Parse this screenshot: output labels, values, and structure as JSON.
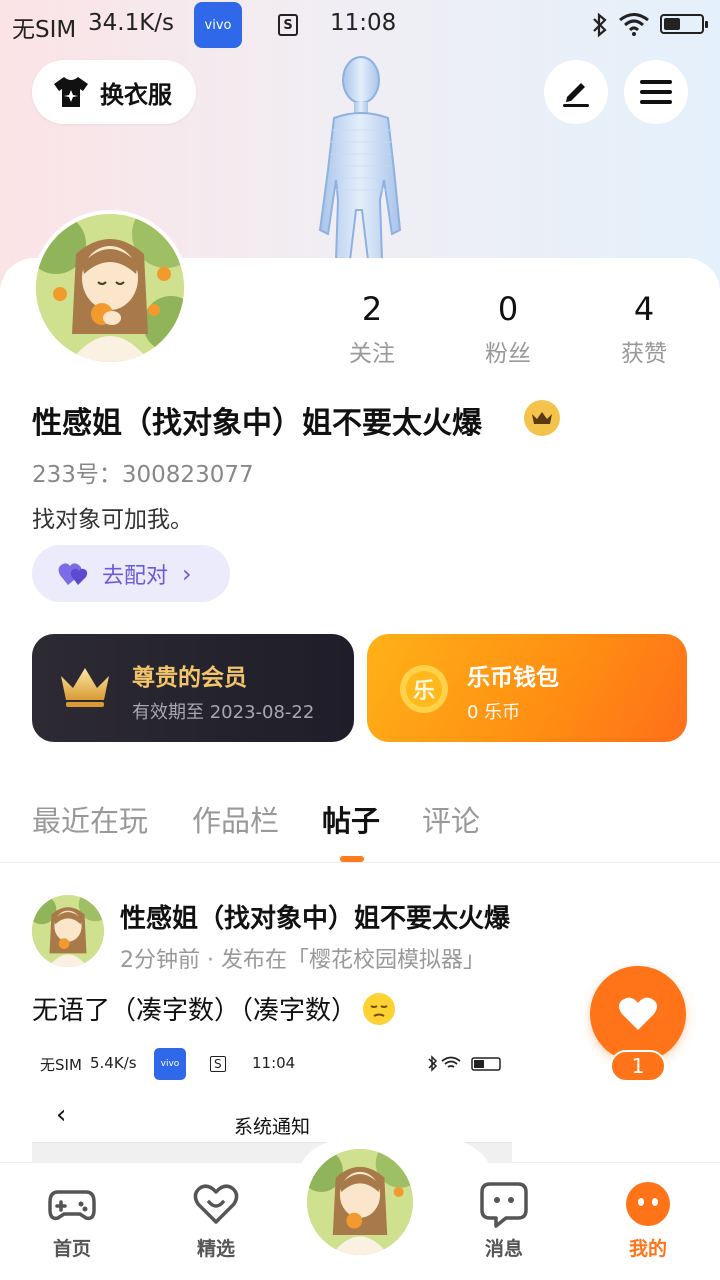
{
  "status_bar": {
    "carrier": "无SIM",
    "speed": "34.1K/s",
    "vivo_label": "vivo",
    "sim_icon": "S",
    "time": "11:08"
  },
  "header": {
    "outfit_label": "换衣服",
    "edit_icon": "pen-icon",
    "menu_icon": "menu-icon"
  },
  "profile": {
    "stats": [
      {
        "value": "2",
        "label": "关注"
      },
      {
        "value": "0",
        "label": "粉丝"
      },
      {
        "value": "4",
        "label": "获赞"
      }
    ],
    "username": "性感姐（找对象中）姐不要太火爆",
    "uid": "233号：300823077",
    "bio": "找对象可加我。",
    "match_label": "去配对"
  },
  "cards": {
    "vip": {
      "title": "尊贵的会员",
      "subtitle": "有效期至 2023-08-22"
    },
    "coin": {
      "icon_char": "乐",
      "title": "乐币钱包",
      "subtitle": "0 乐币"
    }
  },
  "tabs": [
    "最近在玩",
    "作品栏",
    "帖子",
    "评论"
  ],
  "active_tab": "帖子",
  "post": {
    "author": "性感姐（找对象中）姐不要太火爆",
    "meta": "2分钟前 · 发布在「樱花校园模拟器」",
    "text": "无语了（凑字数）（凑字数）",
    "screenshot": {
      "carrier": "无SIM",
      "speed": "5.4K/s",
      "vivo_label": "vivo",
      "sim_icon": "S",
      "time": "11:04",
      "title": "系统通知"
    },
    "likes": "1"
  },
  "bottom_nav": [
    {
      "label": "首页",
      "icon": "gamepad-icon"
    },
    {
      "label": "精选",
      "icon": "heart-smile-icon"
    },
    {
      "label": "消息",
      "icon": "chat-icon"
    },
    {
      "label": "我的",
      "icon": "face-icon"
    }
  ],
  "colors": {
    "accent": "#ff7418",
    "vip_gold": "#f3c56a",
    "match_purple": "#6b5bdc"
  }
}
